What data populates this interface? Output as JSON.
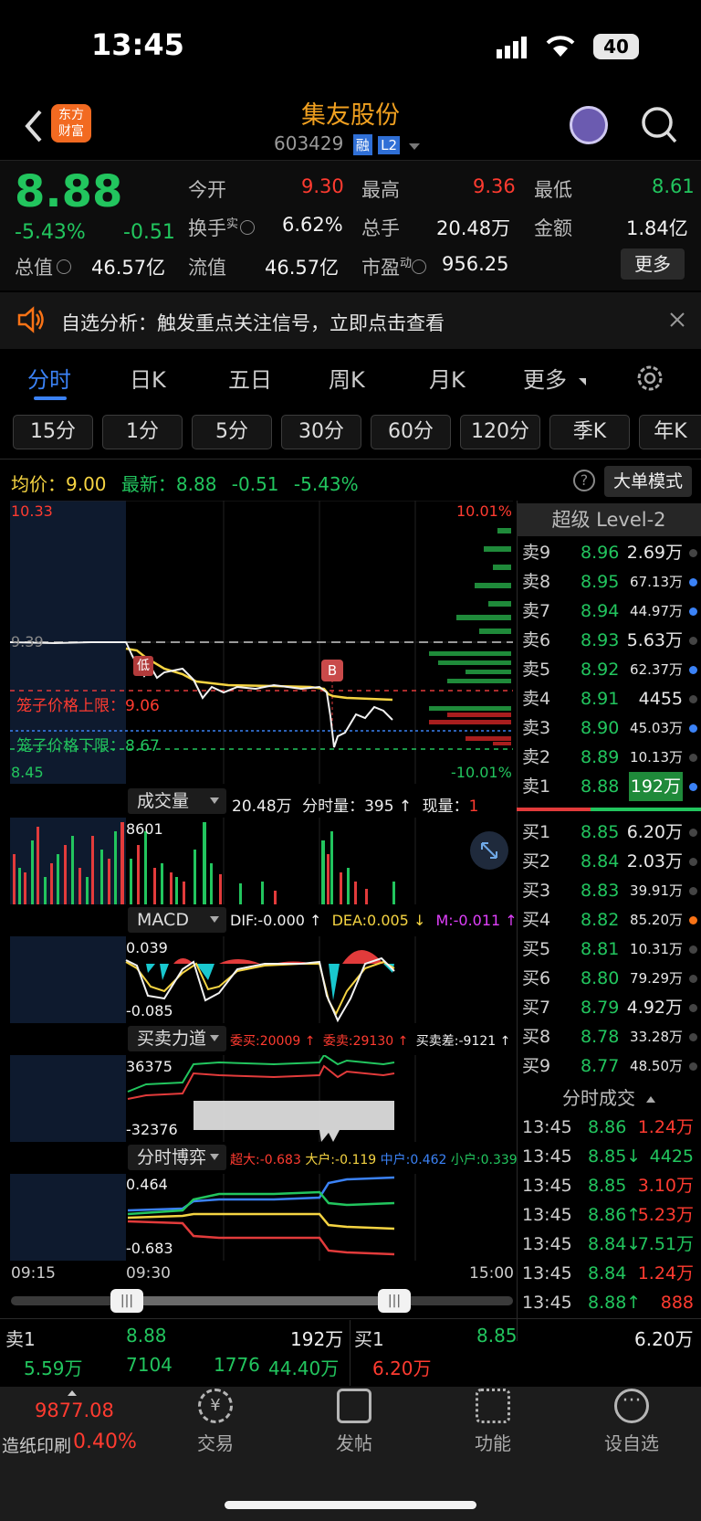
{
  "status": {
    "time": "13:45",
    "battery": "40"
  },
  "header": {
    "logo_line1": "东方",
    "logo_line2": "财富",
    "title": "集友股份",
    "code": "603429",
    "badge_rong": "融",
    "badge_l2": "L2"
  },
  "quote": {
    "price": "8.88",
    "pct": "-5.43%",
    "chg": "-0.51",
    "labels": {
      "open": "今开",
      "high": "最高",
      "low": "最低",
      "turnover": "换手",
      "turnover_sup": "实",
      "total_vol": "总手",
      "amount": "金额",
      "mcap": "总值",
      "float": "流值",
      "pe": "市盈",
      "pe_sup": "动"
    },
    "values": {
      "open": "9.30",
      "high": "9.36",
      "low": "8.61",
      "turnover": "6.62%",
      "total_vol": "20.48万",
      "amount": "1.84亿",
      "mcap": "46.57亿",
      "float": "46.57亿",
      "pe": "956.25"
    },
    "more": "更多"
  },
  "notice": {
    "text": "自选分析：触发重点关注信号，立即点击查看"
  },
  "tabs": [
    "分时",
    "日K",
    "五日",
    "周K",
    "月K",
    "更多"
  ],
  "periods": [
    "15分",
    "1分",
    "5分",
    "30分",
    "60分",
    "120分",
    "季K",
    "年K"
  ],
  "info": {
    "avg_label": "均价：",
    "avg": "9.00",
    "latest_label": "最新：",
    "latest": "8.88",
    "chg": "-0.51",
    "pct": "-5.43%",
    "big_order": "大单模式"
  },
  "chart": {
    "high_price": "10.33",
    "low_price": "8.45",
    "high_pct": "10.01%",
    "low_pct": "-10.01%",
    "preclose": "9.39",
    "cage_up": "笼子价格上限：9.06",
    "cage_down": "笼子价格下限：8.67",
    "marker_low": "低",
    "marker_b": "B",
    "time_start": "09:15",
    "time_open": "09:30",
    "time_end": "15:00"
  },
  "volume": {
    "label": "成交量",
    "total": "20.48万",
    "min_vol": "分时量：395 ↑",
    "now_label": "现量：",
    "now": "1",
    "max": "8601"
  },
  "macd": {
    "label": "MACD",
    "dif": "DIF:-0.000 ↑",
    "dea": "DEA:0.005 ↓",
    "m": "M:-0.011 ↑",
    "top": "0.039",
    "bottom": "-0.085"
  },
  "force": {
    "label": "买卖力道",
    "buy": "委买:20009 ↑",
    "sell": "委卖:29130 ↑",
    "diff": "买卖差:-9121 ↑",
    "top": "36375",
    "bottom": "-32376"
  },
  "game": {
    "label": "分时博弈",
    "super": "超大:-0.683",
    "big": "大户:-0.119",
    "mid": "中户:0.462",
    "small": "小户:0.339",
    "top": "0.464",
    "bottom": "-0.683"
  },
  "orderbook": {
    "title": "超级 Level-2",
    "asks": [
      {
        "l": "卖9",
        "p": "8.96",
        "v": "2.69万",
        "c": "#444"
      },
      {
        "l": "卖8",
        "p": "8.95",
        "v": "67.13万",
        "c": "#3b82f6"
      },
      {
        "l": "卖7",
        "p": "8.94",
        "v": "44.97万",
        "c": "#3b82f6"
      },
      {
        "l": "卖6",
        "p": "8.93",
        "v": "5.63万",
        "c": "#444"
      },
      {
        "l": "卖5",
        "p": "8.92",
        "v": "62.37万",
        "c": "#3b82f6"
      },
      {
        "l": "卖4",
        "p": "8.91",
        "v": "4455",
        "c": "#444"
      },
      {
        "l": "卖3",
        "p": "8.90",
        "v": "45.03万",
        "c": "#3b82f6"
      },
      {
        "l": "卖2",
        "p": "8.89",
        "v": "10.13万",
        "c": "#444"
      },
      {
        "l": "卖1",
        "p": "8.88",
        "v": "192万",
        "c": "#3b82f6"
      }
    ],
    "bids": [
      {
        "l": "买1",
        "p": "8.85",
        "v": "6.20万",
        "c": "#444"
      },
      {
        "l": "买2",
        "p": "8.84",
        "v": "2.03万",
        "c": "#444"
      },
      {
        "l": "买3",
        "p": "8.83",
        "v": "39.91万",
        "c": "#444"
      },
      {
        "l": "买4",
        "p": "8.82",
        "v": "85.20万",
        "c": "#f97316"
      },
      {
        "l": "买5",
        "p": "8.81",
        "v": "10.31万",
        "c": "#444"
      },
      {
        "l": "买6",
        "p": "8.80",
        "v": "79.29万",
        "c": "#444"
      },
      {
        "l": "买7",
        "p": "8.79",
        "v": "4.92万",
        "c": "#444"
      },
      {
        "l": "买8",
        "p": "8.78",
        "v": "33.28万",
        "c": "#444"
      },
      {
        "l": "买9",
        "p": "8.77",
        "v": "48.50万",
        "c": "#444"
      }
    ]
  },
  "trades": {
    "title": "分时成交",
    "rows": [
      {
        "t": "13:45",
        "p": "8.86",
        "v": "1.24万",
        "pc": "green",
        "vc": "red"
      },
      {
        "t": "13:45",
        "p": "8.85↓",
        "v": "4425",
        "pc": "green",
        "vc": "green"
      },
      {
        "t": "13:45",
        "p": "8.85",
        "v": "3.10万",
        "pc": "green",
        "vc": "red"
      },
      {
        "t": "13:45",
        "p": "8.86↑",
        "v": "5.23万",
        "pc": "green",
        "vc": "red"
      },
      {
        "t": "13:45",
        "p": "8.84↓",
        "v": "7.51万",
        "pc": "green",
        "vc": "green"
      },
      {
        "t": "13:45",
        "p": "8.84",
        "v": "1.24万",
        "pc": "green",
        "vc": "red"
      },
      {
        "t": "13:45",
        "p": "8.88↑",
        "v": "888",
        "pc": "green",
        "vc": "red"
      }
    ]
  },
  "bottom_bar": {
    "sell_label": "卖1",
    "sell_price": "8.88",
    "sell_vol": "192万",
    "buy_label": "买1",
    "buy_price": "8.85",
    "buy_vol": "6.20万",
    "row2": [
      "5.59万",
      "7104",
      "1776",
      "44.40万"
    ],
    "row2_right": "6.20万"
  },
  "index": {
    "value": "9877.08",
    "name": "造纸印刷",
    "pct": "0.40%"
  },
  "nav": [
    "交易",
    "发帖",
    "功能",
    "设自选"
  ]
}
